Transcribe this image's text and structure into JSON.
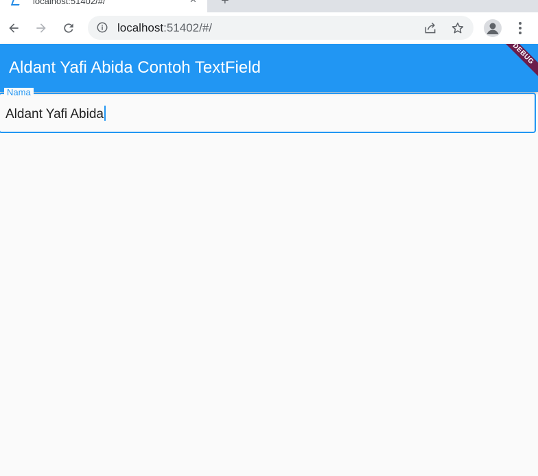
{
  "browser": {
    "tab": {
      "title": "localhost:51402/#/",
      "close_glyph": "✕"
    },
    "new_tab_glyph": "+",
    "address_bar": {
      "host": "localhost",
      "rest": ":51402/#/"
    },
    "icons": [
      "back-arrow-icon",
      "forward-arrow-icon",
      "reload-icon",
      "info-icon",
      "share-icon",
      "star-icon",
      "profile-icon",
      "more-vert-icon"
    ]
  },
  "app": {
    "title": "Aldant Yafi Abida Contoh TextField",
    "debug_banner": "DEBUG",
    "primary_color": "#2196f3",
    "text_field": {
      "label": "Nama",
      "value": "Aldant Yafi Abida"
    }
  }
}
